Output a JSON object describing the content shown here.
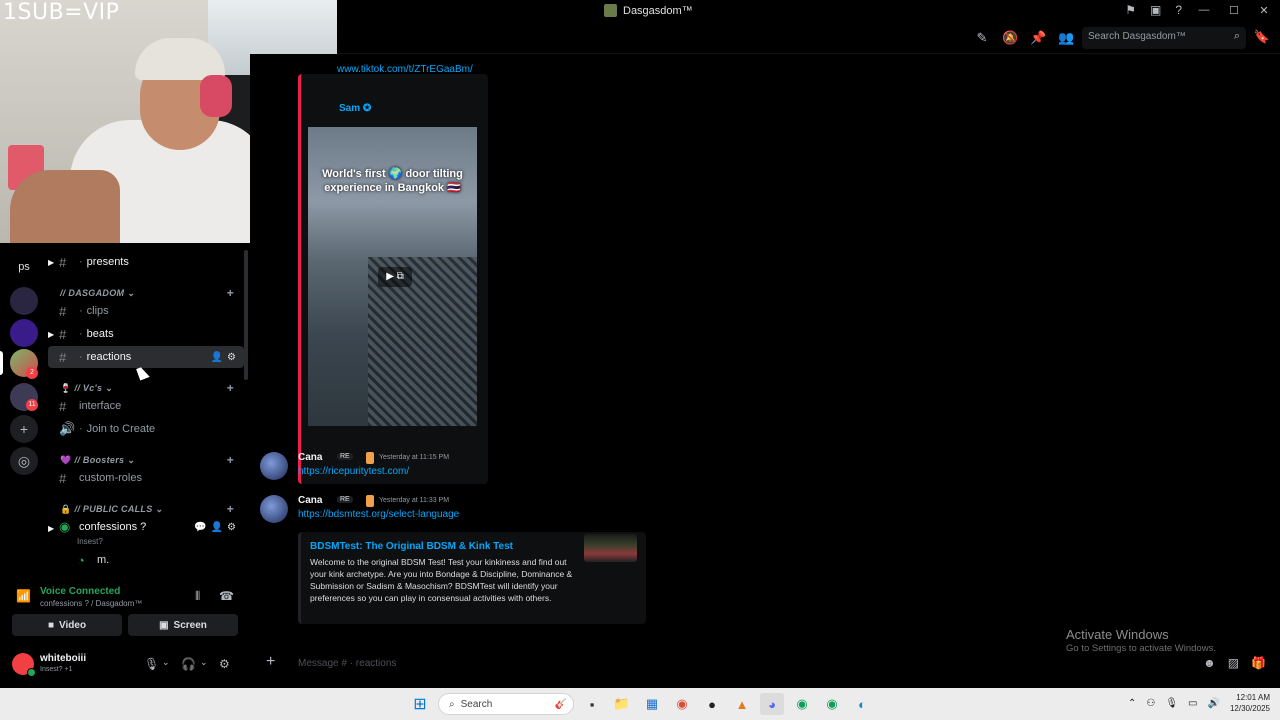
{
  "overlay": {
    "stream_text": "1SUB=VIP"
  },
  "window": {
    "title": "Dasgasdom™"
  },
  "header": {
    "search_placeholder": "Search Dasgasdom™"
  },
  "server_rail": {
    "top_label": "ps",
    "badges": [
      "2",
      "11"
    ]
  },
  "channels": {
    "presents": "presents",
    "cat_dasgasdom": "// DASGADOM",
    "clips": "clips",
    "beats": "beats",
    "reactions": "reactions",
    "cat_vcs": "// Vc's",
    "interface": "interface",
    "join_to_create": "Join to Create",
    "cat_boosters": "// Boosters",
    "custom_roles": "custom-roles",
    "cat_public_calls": "// PUBLIC CALLS",
    "confessions": "confessions ?",
    "confessions_sub": "Insest?",
    "voice_member": "m."
  },
  "voice": {
    "status": "Voice Connected",
    "location": "confessions ? / Dasgadom™",
    "video_label": "Video",
    "screen_label": "Screen"
  },
  "user": {
    "name": "whiteboiii",
    "status": "Insest? +1"
  },
  "chat": {
    "tiktok_url": "www.tiktok.com/t/ZTrEGaaBm/",
    "embed_author": "Sam",
    "video_caption": "World's first 🌍 door tilting experience in Bangkok 🇹🇭",
    "messages": [
      {
        "author": "Cana",
        "tag": "RE",
        "time": "Yesterday at 11:15 PM",
        "url": "https://ricepuritytest.com/"
      },
      {
        "author": "Cana",
        "tag": "RE",
        "time": "Yesterday at 11:33 PM",
        "url": "https://bdsmtest.org/select-language"
      }
    ],
    "embed": {
      "title": "BDSMTest: The Original BDSM & Kink Test",
      "description": "Welcome to the original BDSM Test! Test your kinkiness and find out your kink archetype. Are you into Bondage & Discipline, Dominance & Submission or Sadism & Masochism? BDSMTest will identify your preferences so you can play in consensual activities with others."
    },
    "composer_placeholder": "Message # · reactions"
  },
  "watermark": {
    "title": "Activate Windows",
    "subtitle": "Go to Settings to activate Windows."
  },
  "taskbar": {
    "search_label": "Search",
    "time": "12:01 AM",
    "date": "12/30/2025"
  }
}
